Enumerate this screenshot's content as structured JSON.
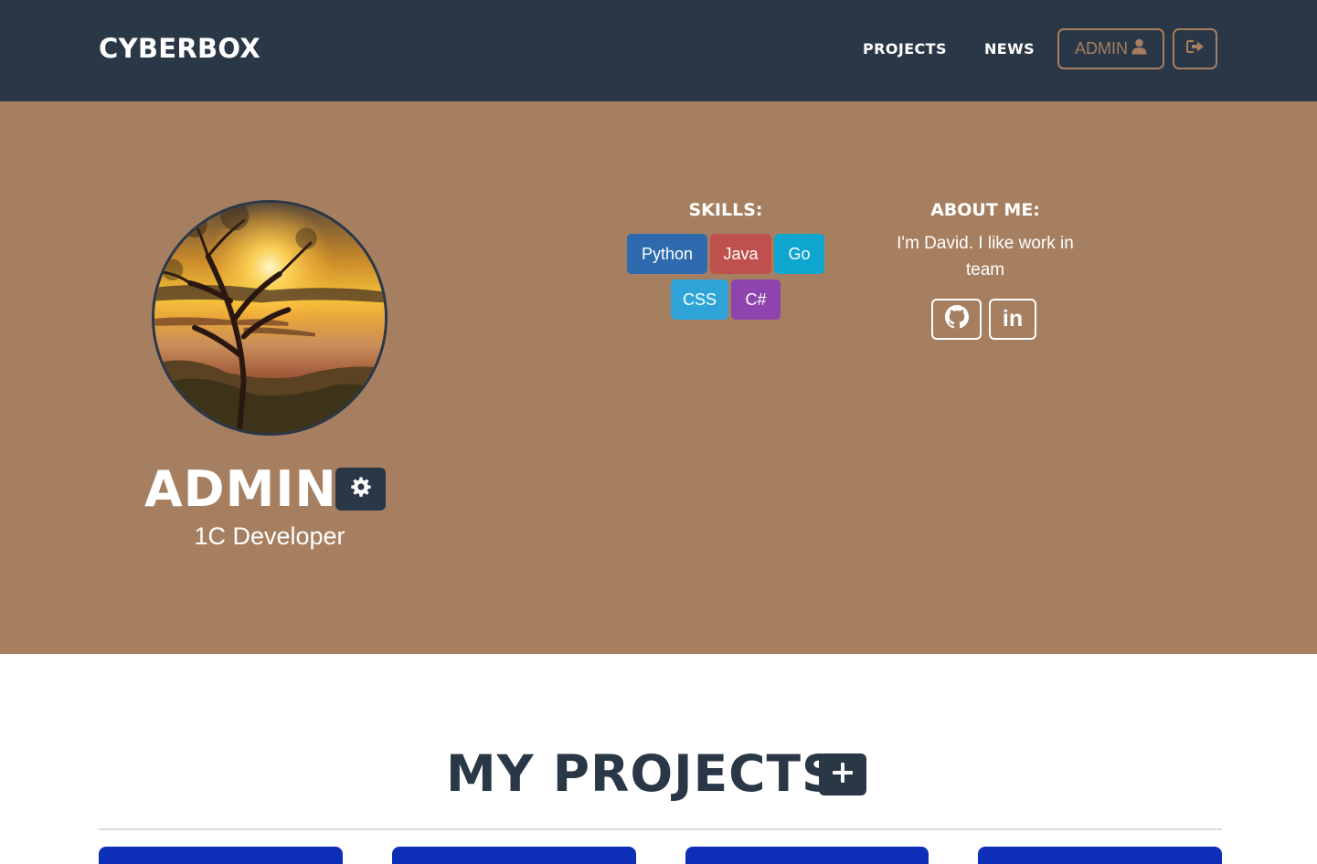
{
  "navbar": {
    "brand": "CYBERBOX",
    "links": [
      "PROJECTS",
      "NEWS"
    ],
    "admin_button_label": "ADMIN",
    "admin_button_icon": "user-icon",
    "logout_icon": "sign-out-icon"
  },
  "profile": {
    "avatar_alt": "sunset over lake with tree silhouette",
    "name": "ADMIN",
    "settings_icon": "gear-icon",
    "role": "1C Developer"
  },
  "skills": {
    "title": "SKILLS:",
    "items": [
      {
        "label": "Python",
        "color": "#2e6aad"
      },
      {
        "label": "Java",
        "color": "#c0504d"
      },
      {
        "label": "Go",
        "color": "#0ea5cf"
      },
      {
        "label": "CSS",
        "color": "#2ea4d8"
      },
      {
        "label": "C#",
        "color": "#8e44ad"
      }
    ]
  },
  "about": {
    "title": "ABOUT ME:",
    "text": "I'm David. I like work in team",
    "socials": [
      "github-icon",
      "linkedin-icon"
    ],
    "linkedin_text": "in"
  },
  "projects": {
    "title": "MY PROJECTS",
    "add_icon": "plus-icon"
  },
  "colors": {
    "navbar": "#2a3747",
    "hero": "#a67f60",
    "card": "#0d2fb8"
  }
}
